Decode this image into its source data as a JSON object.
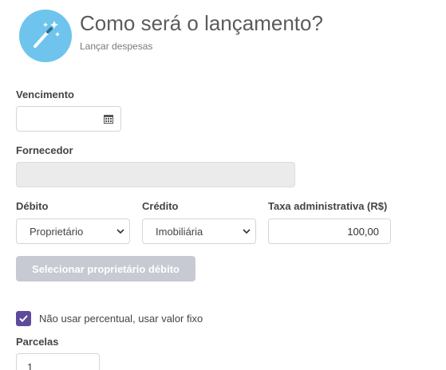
{
  "header": {
    "title": "Como será o lançamento?",
    "subtitle": "Lançar despesas",
    "icon": "magic-wand-icon",
    "icon_color": "#6ec4ec"
  },
  "form": {
    "vencimento": {
      "label": "Vencimento",
      "value": "",
      "icon": "calendar-icon"
    },
    "fornecedor": {
      "label": "Fornecedor",
      "value": ""
    },
    "debito": {
      "label": "Débito",
      "selected": "Proprietário"
    },
    "credito": {
      "label": "Crédito",
      "selected": "Imobiliária"
    },
    "taxa": {
      "label": "Taxa administrativa (R$)",
      "value": "100,00"
    },
    "select_button": {
      "label": "Selecionar proprietário débito",
      "color": "#c7cad3"
    },
    "fixed_value": {
      "label": "Não usar percentual, usar valor fixo",
      "checked": true,
      "color": "#5e4a9b"
    },
    "parcelas": {
      "label": "Parcelas",
      "value": "1"
    }
  }
}
